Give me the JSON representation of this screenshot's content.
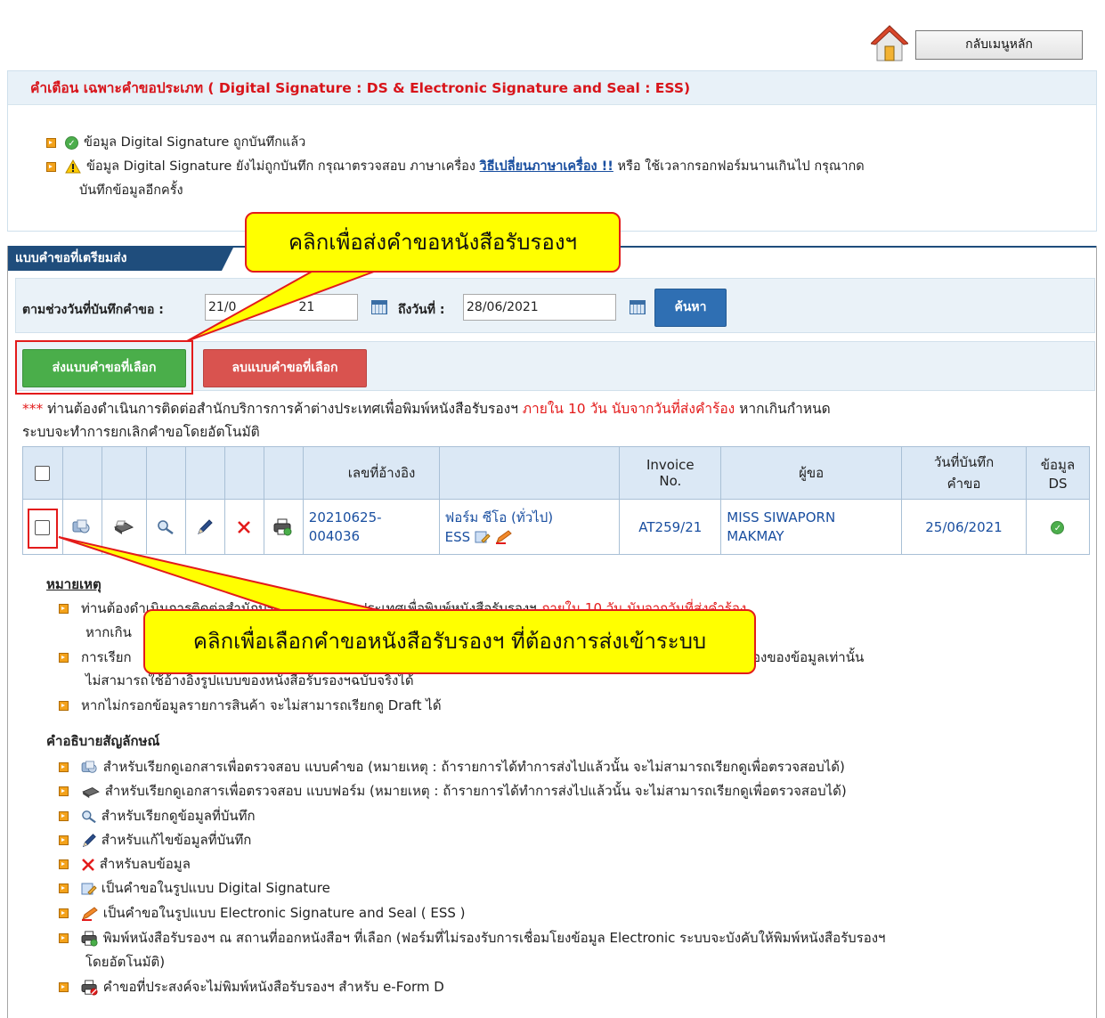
{
  "header": {
    "home_button": "กลับเมนูหลัก"
  },
  "warning": {
    "title": "คำเตือน เฉพาะคำขอประเภท ( Digital Signature : DS & Electronic Signature and Seal : ESS)",
    "line1": "ข้อมูล Digital Signature ถูกบันทึกแล้ว",
    "line2_a": "ข้อมูล Digital Signature ยังไม่ถูกบันทึก กรุณาตรวจสอบ ภาษาเครื่อง",
    "line2_link": "วิธีเปลี่ยนภาษาเครื่อง !!",
    "line2_b": "หรือ ใช้เวลากรอกฟอร์มนานเกินไป กรุณากด",
    "line2_c": "บันทึกข้อมูลอีกครั้ง"
  },
  "panel": {
    "tab_label": "แบบคำขอที่เตรียมส่ง"
  },
  "search": {
    "from_label": "ตามช่วงวันที่บันทึกคำขอ :",
    "from_value": "21/0",
    "from_value_tail": "21",
    "to_label": "ถึงวันที่ :",
    "to_value": "28/06/2021",
    "search_button": "ค้นหา"
  },
  "actions": {
    "send_button": "ส่งแบบคำขอที่เลือก",
    "delete_button": "ลบแบบคำขอที่เลือก"
  },
  "notice": {
    "stars": "***",
    "text_a": " ท่านต้องดำเนินการติดต่อสำนักบริการการค้าต่างประเทศเพื่อพิมพ์หนังสือรับรองฯ ",
    "text_red": "ภายใน 10 วัน นับจากวันที่ส่งคำร้อง",
    "text_b": " หากเกินกำหนด",
    "text_c": "ระบบจะทำการยกเลิกคำขอโดยอัตโนมัติ"
  },
  "table": {
    "headers": {
      "ref": "เลขที่อ้างอิง",
      "invoice_1": "Invoice",
      "invoice_2": "No.",
      "requester": "ผู้ขอ",
      "date_1": "วันที่บันทึก",
      "date_2": "คำขอ",
      "ds_1": "ข้อมูล",
      "ds_2": "DS"
    },
    "rows": [
      {
        "ref_1": "20210625-",
        "ref_2": "004036",
        "form_1": "ฟอร์ม ซีโอ (ทั่วไป)",
        "form_2": "ESS",
        "invoice": "AT259/21",
        "requester_1": "MISS SIWAPORN",
        "requester_2": "MAKMAY",
        "date": "25/06/2021"
      }
    ]
  },
  "remarks": {
    "title": "หมายเหตุ",
    "r1_a": "ท่านต้องดำเนินการติดต่อสำนักบริการการค้าต่างประเทศเพื่อพิมพ์หนังสือรับรองฯ",
    "r1_red": "ภายใน 10 วัน นับจากวันที่ส่งคำร้อง",
    "r1_b": "หากเกิน",
    "r2_a": "การเรียก",
    "r2_b": "องของข้อมูลเท่านั้น",
    "r2_c": "ไม่สามารถใช้อ้างอิงรูปแบบของหนังสือรับรองฯฉบับจริงได้",
    "r3": "หากไม่กรอกข้อมูลรายการสินค้า จะไม่สามารถเรียกดู Draft ได้"
  },
  "legend": {
    "title": "คำอธิบายสัญลักษณ์",
    "items": [
      "สำหรับเรียกดูเอกสารเพื่อตรวจสอบ แบบคำขอ (หมายเหตุ : ถ้ารายการได้ทำการส่งไปแล้วนั้น จะไม่สามารถเรียกดูเพื่อตรวจสอบได้)",
      "สำหรับเรียกดูเอกสารเพื่อตรวจสอบ แบบฟอร์ม (หมายเหตุ : ถ้ารายการได้ทำการส่งไปแล้วนั้น จะไม่สามารถเรียกดูเพื่อตรวจสอบได้)",
      "สำหรับเรียกดูข้อมูลที่บันทึก",
      "สำหรับแก้ไขข้อมูลที่บันทึก",
      "สำหรับลบข้อมูล",
      "เป็นคำขอในรูปแบบ Digital Signature",
      "เป็นคำขอในรูปแบบ Electronic Signature and Seal ( ESS )",
      "พิมพ์หนังสือรับรองฯ ณ สถานที่ออกหนังสือฯ ที่เลือก (ฟอร์มที่ไม่รองรับการเชื่อมโยงข้อมูล Electronic ระบบจะบังคับให้พิมพ์หนังสือรับรองฯ",
      "โดยอัตโนมัติ)",
      "คำขอที่ประสงค์จะไม่พิมพ์หนังสือรับรองฯ สำหรับ e-Form D"
    ]
  },
  "callouts": {
    "top": "คลิกเพื่อส่งคำขอหนังสือรับรองฯ",
    "bottom": "คลิกเพื่อเลือกคำขอหนังสือรับรองฯ ที่ต้องการส่งเข้าระบบ"
  },
  "colors": {
    "brand_blue": "#1f4d7c",
    "send_green": "#4aae4a",
    "delete_red": "#d9534f",
    "callout_yellow": "#ffff00",
    "alert_red": "#e31b1b"
  }
}
